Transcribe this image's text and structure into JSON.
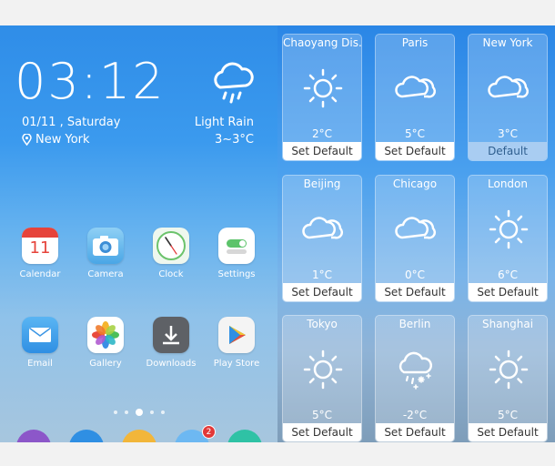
{
  "home": {
    "time": "03:12",
    "date": "01/11 , Saturday",
    "location": "New York",
    "condition": "Light Rain",
    "temp_range": "3~3°C",
    "weather_icon": "cloud-rain-icon",
    "apps_row1": [
      {
        "label": "Calendar",
        "icon": "calendar-icon",
        "calendar_day": "11"
      },
      {
        "label": "Camera",
        "icon": "camera-icon"
      },
      {
        "label": "Clock",
        "icon": "clock-icon"
      },
      {
        "label": "Settings",
        "icon": "settings-icon"
      }
    ],
    "apps_row2": [
      {
        "label": "Email",
        "icon": "email-icon"
      },
      {
        "label": "Gallery",
        "icon": "gallery-icon"
      },
      {
        "label": "Downloads",
        "icon": "downloads-icon"
      },
      {
        "label": "Play Store",
        "icon": "play-store-icon"
      }
    ],
    "page_indicator": {
      "pages": 5,
      "current": 3
    },
    "dock_badge": "2"
  },
  "cities": [
    {
      "name": "Chaoyang Dis...",
      "temp": "2°C",
      "icon": "sun-icon",
      "button": "Set Default",
      "selected": false
    },
    {
      "name": "Paris",
      "temp": "5°C",
      "icon": "cloud-icon",
      "button": "Set Default",
      "selected": false
    },
    {
      "name": "New York",
      "temp": "3°C",
      "icon": "cloud-icon",
      "button": "Default",
      "selected": true
    },
    {
      "name": "Beijing",
      "temp": "1°C",
      "icon": "cloud-icon",
      "button": "Set Default",
      "selected": false
    },
    {
      "name": "Chicago",
      "temp": "0°C",
      "icon": "cloud-icon",
      "button": "Set Default",
      "selected": false
    },
    {
      "name": "London",
      "temp": "6°C",
      "icon": "sun-icon",
      "button": "Set Default",
      "selected": false
    },
    {
      "name": "Tokyo",
      "temp": "5°C",
      "icon": "sun-icon",
      "button": "Set Default",
      "selected": false
    },
    {
      "name": "Berlin",
      "temp": "-2°C",
      "icon": "cloud-snow-icon",
      "button": "Set Default",
      "selected": false
    },
    {
      "name": "Shanghai",
      "temp": "5°C",
      "icon": "sun-icon",
      "button": "Set Default",
      "selected": false
    }
  ]
}
